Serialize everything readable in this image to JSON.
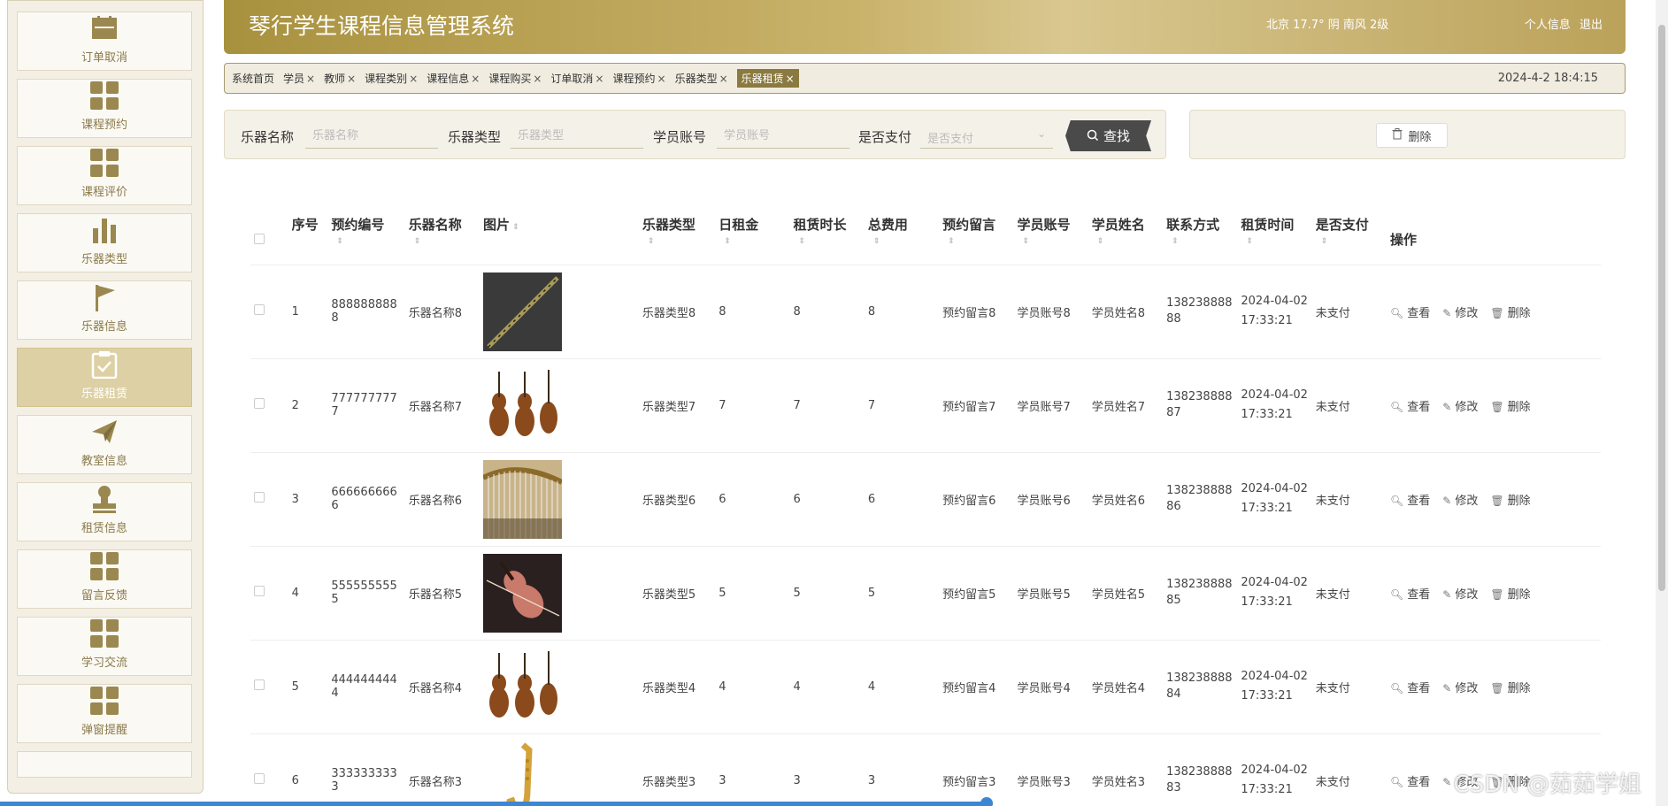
{
  "header": {
    "title": "琴行学生课程信息管理系统",
    "weather": "北京  17.7°  阴  南风  2级",
    "profile": "个人信息",
    "logout": "退出"
  },
  "sidebar": {
    "items": [
      {
        "label": "订单取消",
        "icon": "calendar-icon"
      },
      {
        "label": "课程预约",
        "icon": "grid-icon"
      },
      {
        "label": "课程评价",
        "icon": "grid-icon"
      },
      {
        "label": "乐器类型",
        "icon": "bar-chart-icon"
      },
      {
        "label": "乐器信息",
        "icon": "flag-icon"
      },
      {
        "label": "乐器租赁",
        "icon": "clipboard-check-icon",
        "active": true
      },
      {
        "label": "教室信息",
        "icon": "paper-plane-icon"
      },
      {
        "label": "租赁信息",
        "icon": "stamp-icon"
      },
      {
        "label": "留言反馈",
        "icon": "grid-icon"
      },
      {
        "label": "学习交流",
        "icon": "grid-icon"
      },
      {
        "label": "弹窗提醒",
        "icon": "grid-icon"
      }
    ]
  },
  "tabs": {
    "items": [
      "系统首页",
      "学员",
      "教师",
      "课程类别",
      "课程信息",
      "课程购买",
      "订单取消",
      "课程预约",
      "乐器类型",
      "乐器租赁"
    ],
    "close": "×",
    "datetime": "2024-4-2 18:4:15"
  },
  "search": {
    "f1_label": "乐器名称",
    "f1_placeholder": "乐器名称",
    "f2_label": "乐器类型",
    "f2_placeholder": "乐器类型",
    "f3_label": "学员账号",
    "f3_placeholder": "学员账号",
    "f4_label": "是否支付",
    "f4_placeholder": "是否支付",
    "button": "查找"
  },
  "actions": {
    "delete": "删除"
  },
  "table": {
    "headers": [
      "序号",
      "预约编号",
      "乐器名称",
      "图片",
      "乐器类型",
      "日租金",
      "租赁时长",
      "总费用",
      "预约留言",
      "学员账号",
      "学员姓名",
      "联系方式",
      "租赁时间",
      "是否支付",
      "操作"
    ],
    "ops": {
      "view": "查看",
      "edit": "修改",
      "delete": "删除"
    },
    "rows": [
      {
        "idx": "1",
        "code": "8888888888",
        "name": "乐器名称8",
        "img": "clarinet",
        "type": "乐器类型8",
        "rent": "8",
        "dur": "8",
        "total": "8",
        "msg": "预约留言8",
        "acct": "学员账号8",
        "sname": "学员姓名8",
        "phone": "13823888888",
        "time": "2024-04-02 17:33:21",
        "paid": "未支付"
      },
      {
        "idx": "2",
        "code": "7777777777",
        "name": "乐器名称7",
        "img": "strings",
        "type": "乐器类型7",
        "rent": "7",
        "dur": "7",
        "total": "7",
        "msg": "预约留言7",
        "acct": "学员账号7",
        "sname": "学员姓名7",
        "phone": "13823888887",
        "time": "2024-04-02 17:33:21",
        "paid": "未支付"
      },
      {
        "idx": "3",
        "code": "6666666666",
        "name": "乐器名称6",
        "img": "harp",
        "type": "乐器类型6",
        "rent": "6",
        "dur": "6",
        "total": "6",
        "msg": "预约留言6",
        "acct": "学员账号6",
        "sname": "学员姓名6",
        "phone": "13823888886",
        "time": "2024-04-02 17:33:21",
        "paid": "未支付"
      },
      {
        "idx": "4",
        "code": "5555555555",
        "name": "乐器名称5",
        "img": "violin",
        "type": "乐器类型5",
        "rent": "5",
        "dur": "5",
        "total": "5",
        "msg": "预约留言5",
        "acct": "学员账号5",
        "sname": "学员姓名5",
        "phone": "13823888885",
        "time": "2024-04-02 17:33:21",
        "paid": "未支付"
      },
      {
        "idx": "5",
        "code": "4444444444",
        "name": "乐器名称4",
        "img": "strings",
        "type": "乐器类型4",
        "rent": "4",
        "dur": "4",
        "total": "4",
        "msg": "预约留言4",
        "acct": "学员账号4",
        "sname": "学员姓名4",
        "phone": "13823888884",
        "time": "2024-04-02 17:33:21",
        "paid": "未支付"
      },
      {
        "idx": "6",
        "code": "3333333333",
        "name": "乐器名称3",
        "img": "saxophone",
        "type": "乐器类型3",
        "rent": "3",
        "dur": "3",
        "total": "3",
        "msg": "预约留言3",
        "acct": "学员账号3",
        "sname": "学员姓名3",
        "phone": "13823888883",
        "time": "2024-04-02 17:33:21",
        "paid": "未支付"
      }
    ]
  },
  "watermark": "CSDN @茹茹学姐",
  "colors": {
    "accent": "#a8913e",
    "active_tab": "#8a7a40",
    "button_dark": "#4a4a4a"
  }
}
